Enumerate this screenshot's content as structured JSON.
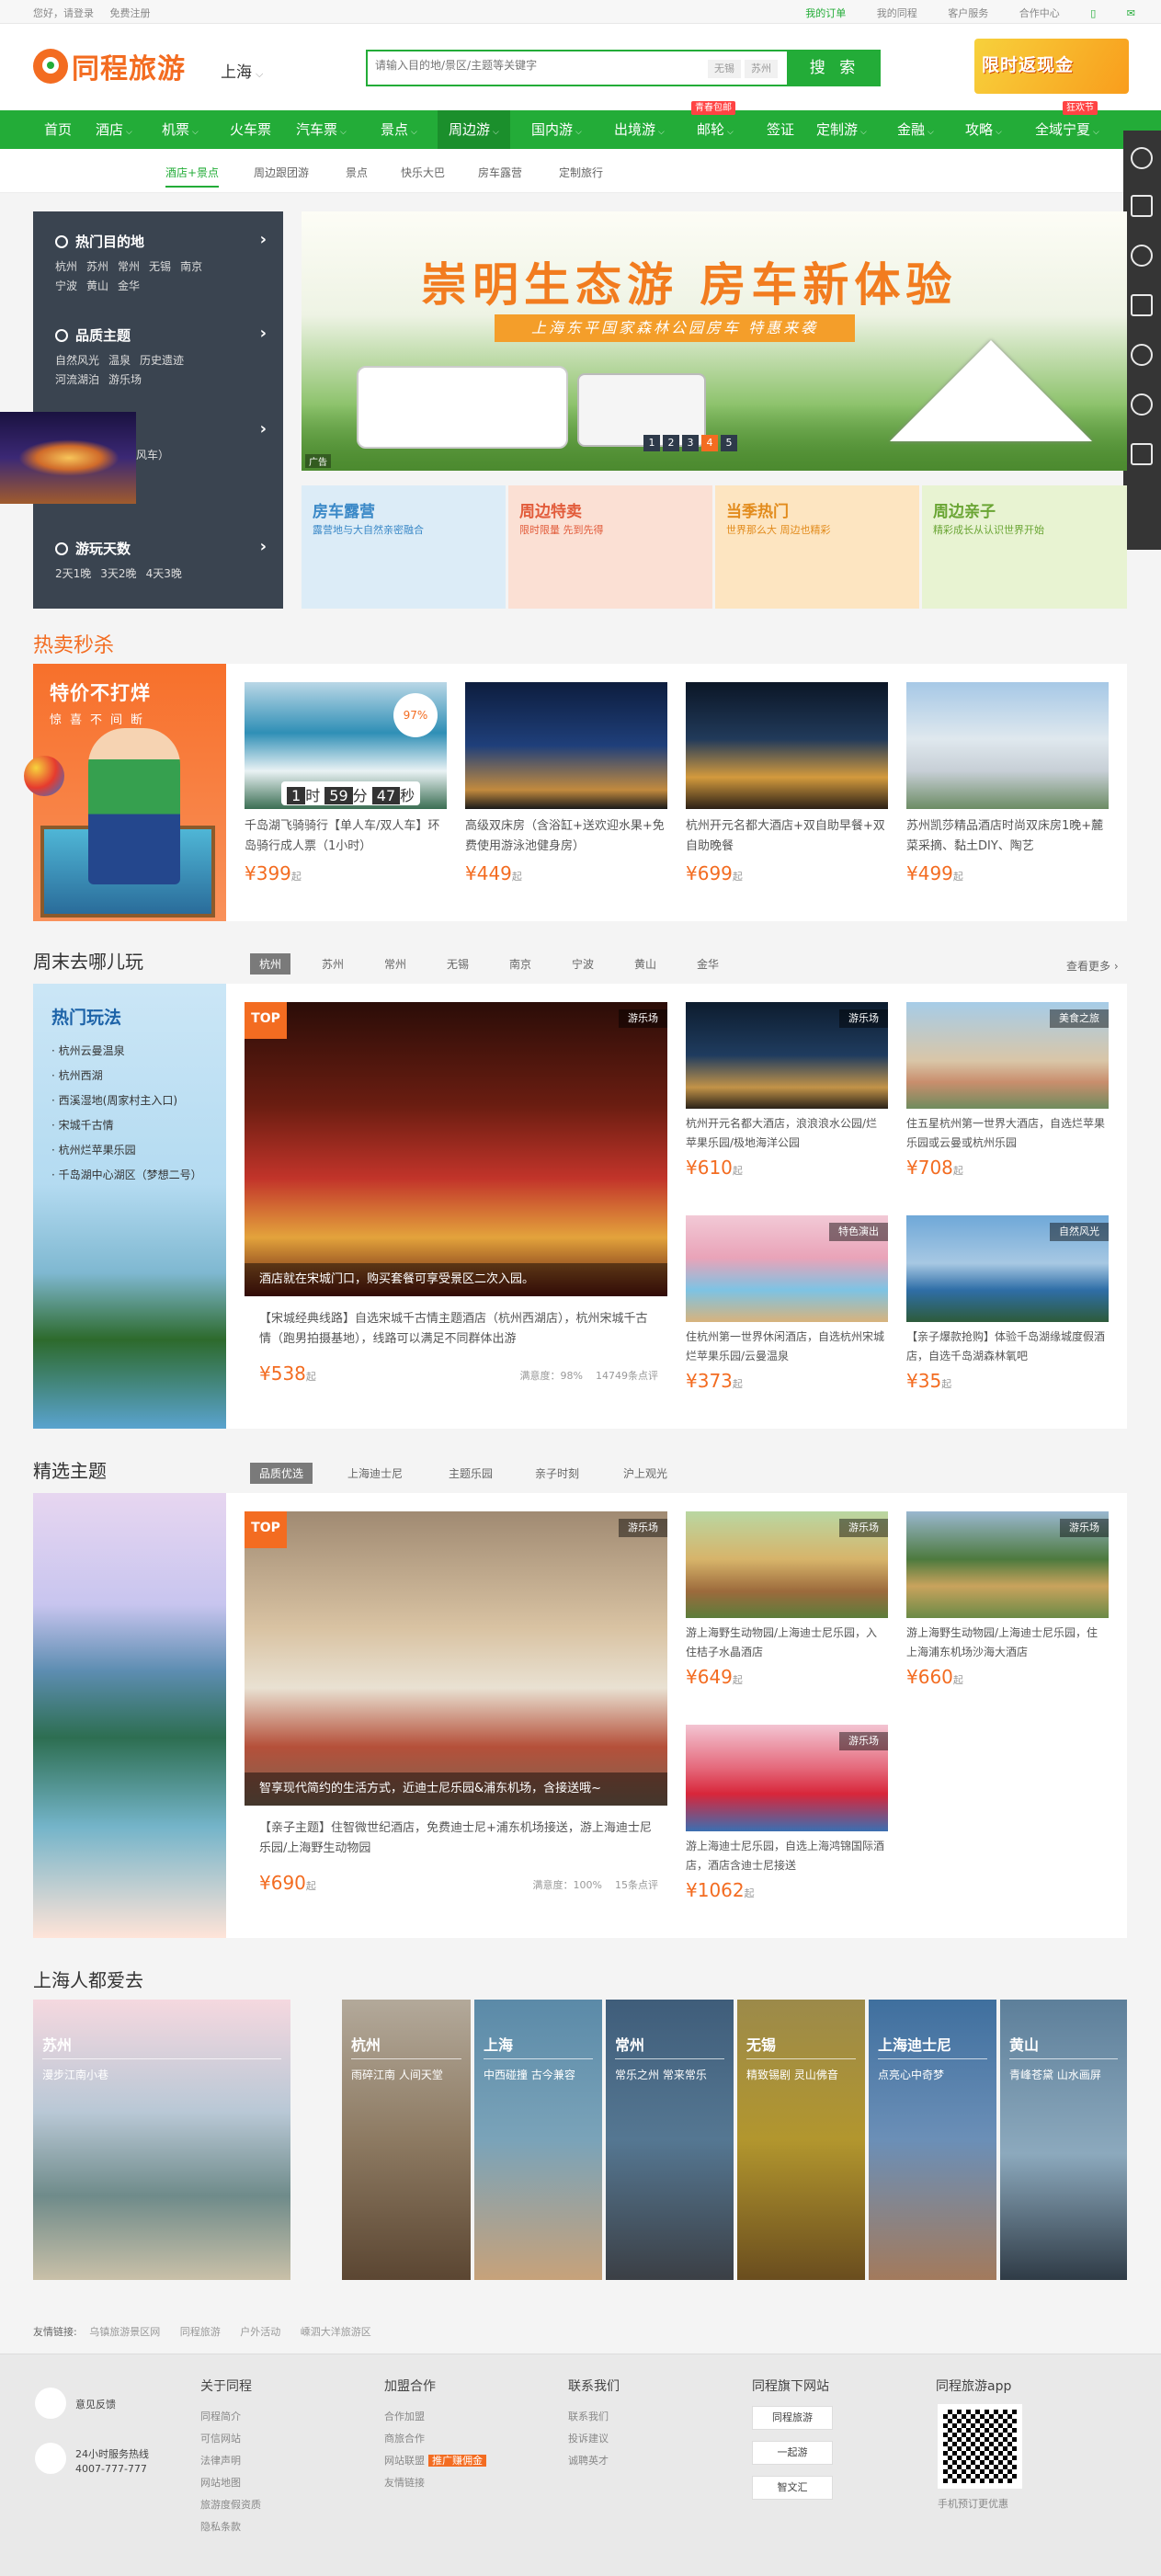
{
  "topbar": {
    "greeting": "您好，请登录",
    "register": "免费注册",
    "my_orders": "我的订单",
    "my_trips": "我的同程",
    "customer_service": "客户服务",
    "partner_center": "合作中心"
  },
  "header": {
    "logo": "同程旅游",
    "city": "上海",
    "search_placeholder": "请输入目的地/景区/主题等关键字",
    "search_tags": [
      "无锡",
      "苏州"
    ],
    "search_button": "搜 索",
    "promo_text": "限时返现金"
  },
  "nav": {
    "items": [
      "首页",
      "酒店",
      "机票",
      "火车票",
      "汽车票",
      "景点",
      "周边游",
      "国内游",
      "出境游",
      "邮轮",
      "签证",
      "定制游",
      "金融",
      "攻略",
      "全域宁夏"
    ],
    "cruise_badge": "青春包邮",
    "ningxia_badge": "狂欢节",
    "active": "周边游"
  },
  "subnav": [
    "酒店+景点",
    "周边跟团游",
    "景点",
    "快乐大巴",
    "房车露营",
    "定制旅行"
  ],
  "category_panel": [
    {
      "title": "热门目的地",
      "links": [
        "杭州",
        "苏州",
        "常州",
        "无锡",
        "南京",
        "宁波",
        "黄山",
        "金华"
      ]
    },
    {
      "title": "品质主题",
      "links": [
        "自然风光",
        "温泉",
        "历史遗迹",
        "河流湖泊",
        "游乐场"
      ]
    },
    {
      "title": "",
      "links": [
        "公园（水风车）",
        "城"
      ]
    },
    {
      "title": "游玩天数",
      "links": [
        "2天1晚",
        "3天2晚",
        "4天3晚"
      ]
    }
  ],
  "banner": {
    "headline": "崇明生态游 房车新体验",
    "subline": "上海东平国家森林公园房车 特惠来袭",
    "pages": [
      "1",
      "2",
      "3",
      "4",
      "5"
    ],
    "ad_label": "广告"
  },
  "mini_banners": [
    {
      "title": "房车露营",
      "sub": "露营地与大自然亲密融合",
      "bg": "#dcecf7",
      "color": "#3a88c7"
    },
    {
      "title": "周边特卖",
      "sub": "限时限量 先到先得",
      "bg": "#fbe0d4",
      "color": "#e25b3a"
    },
    {
      "title": "当季热门",
      "sub": "世界那么大 周边也精彩",
      "bg": "#fde5c1",
      "color": "#e28b1c"
    },
    {
      "title": "周边亲子",
      "sub": "精彩成长从认识世界开始",
      "bg": "#e8f3d2",
      "color": "#6aa534"
    }
  ],
  "hot_sale": {
    "section_title": "热卖秒杀",
    "left_title": "特价不打烊",
    "left_sub": "惊喜不间断",
    "timer": {
      "h": "1",
      "h_unit": "时",
      "m": "59",
      "m_unit": "分",
      "s": "47",
      "s_unit": "秒"
    },
    "discount": "97%",
    "products": [
      {
        "name": "千岛湖飞骑骑行【单人车/双人车】环岛骑行成人票（1小时）",
        "price": "399",
        "unit": "起"
      },
      {
        "name": "高级双床房（含浴缸+送欢迎水果+免费使用游泳池健身房）",
        "price": "449",
        "unit": "起"
      },
      {
        "name": "杭州开元名都大酒店+双自助早餐+双自助晚餐",
        "price": "699",
        "unit": "起"
      },
      {
        "name": "苏州凯莎精品酒店时尚双床房1晚+麓菜采摘、黏土DIY、陶艺",
        "price": "499",
        "unit": "起"
      }
    ]
  },
  "weekend": {
    "section_title": "周末去哪儿玩",
    "tabs": [
      "杭州",
      "苏州",
      "常州",
      "无锡",
      "南京",
      "宁波",
      "黄山",
      "金华"
    ],
    "more": "查看更多 ›",
    "side_title": "热门玩法",
    "side_items": [
      "杭州云曼温泉",
      "杭州西湖",
      "西溪湿地(周家村主入口)",
      "宋城千古情",
      "杭州烂苹果乐园",
      "千岛湖中心湖区（梦想二号）"
    ],
    "big": {
      "top": "TOP",
      "tag": "游乐场",
      "caption": "酒店就在宋城门口，购买套餐可享受景区二次入园。",
      "name": "【宋城经典线路】自选宋城千古情主题酒店（杭州西湖店），杭州宋城千古情（跑男拍摄基地），线路可以满足不同群体出游",
      "price": "538",
      "unit": "起",
      "satisfaction": "满意度：98%",
      "reviews": "14749条点评"
    },
    "cards": [
      {
        "tag": "游乐场",
        "name": "杭州开元名都大酒店，浪浪浪水公园/烂苹果乐园/极地海洋公园",
        "price": "610",
        "unit": "起"
      },
      {
        "tag": "美食之旅",
        "name": "住五星杭州第一世界大酒店，自选烂苹果乐园或云曼或杭州乐园",
        "price": "708",
        "unit": "起"
      },
      {
        "tag": "特色演出",
        "name": "住杭州第一世界休闲酒店，自选杭州宋城烂苹果乐园/云曼温泉",
        "price": "373",
        "unit": "起"
      },
      {
        "tag": "自然风光",
        "name": "【亲子爆款抢购】体验千岛湖缘城度假酒店，自选千岛湖森林氧吧",
        "price": "35",
        "unit": "起"
      }
    ]
  },
  "theme": {
    "section_title": "精选主题",
    "tabs": [
      "品质优选",
      "上海迪士尼",
      "主题乐园",
      "亲子时刻",
      "沪上观光"
    ],
    "big": {
      "top": "TOP",
      "tag": "游乐场",
      "caption": "智享现代简约的生活方式，近迪士尼乐园&浦东机场，含接送哦~",
      "name": "【亲子主题】住智微世纪酒店，免费迪士尼+浦东机场接送，游上海迪士尼乐园/上海野生动物园",
      "price": "690",
      "unit": "起",
      "satisfaction": "满意度：100%",
      "reviews": "15条点评"
    },
    "cards": [
      {
        "tag": "游乐场",
        "name": "游上海野生动物园/上海迪士尼乐园，入住桔子水晶酒店",
        "price": "649",
        "unit": "起"
      },
      {
        "tag": "游乐场",
        "name": "游上海野生动物园/上海迪士尼乐园，住上海浦东机场沙海大酒店",
        "price": "660",
        "unit": "起"
      },
      {
        "tag": "游乐场",
        "name": "游上海迪士尼乐园，自选上海鸿锦国际酒店，酒店含迪士尼接送",
        "price": "1062",
        "unit": "起"
      }
    ]
  },
  "shanghai": {
    "section_title": "上海人都爱去",
    "cities": [
      {
        "name": "苏州",
        "sub": "漫步江南小巷",
        "bg": "linear-gradient(180deg,#f5d8df 0%,#b9c8d6 40%,#6f8b8a 70%,#c9c0a8 100%)"
      },
      {
        "name": "杭州",
        "sub": "雨碎江南 人间天堂",
        "bg": "linear-gradient(180deg,#b3a99a 0%,#8d7a62 50%,#5b4632 100%)"
      },
      {
        "name": "上海",
        "sub": "中西碰撞 古今兼容",
        "bg": "linear-gradient(180deg,#5b8aa8 0%,#7aa3b9 50%,#c7a27a 100%)"
      },
      {
        "name": "常州",
        "sub": "常乐之州 常来常乐",
        "bg": "linear-gradient(180deg,#3f5d7a 0%,#557792 50%,#3b3f45 100%)"
      },
      {
        "name": "无锡",
        "sub": "精致锡剧 灵山佛音",
        "bg": "linear-gradient(180deg,#9c8a4a 0%,#b2962e 50%,#6a4d1e 100%)"
      },
      {
        "name": "上海迪士尼",
        "sub": "点亮心中奇梦",
        "bg": "linear-gradient(180deg,#3f6f9e 0%,#6b8fb7 50%,#a37a5c 100%)"
      },
      {
        "name": "黄山",
        "sub": "青峰苍黛 山水画屏",
        "bg": "linear-gradient(180deg,#5d7f9a 0%,#8ca9bd 55%,#2f3b46 100%)"
      }
    ]
  },
  "friend_links": {
    "label": "友情链接:",
    "links": [
      "乌镇旅游景区网",
      "同程旅游",
      "户外活动",
      "嵊泗大洋旅游区"
    ]
  },
  "footer": {
    "feedback": "意见反馈",
    "hotline_label": "24小时服务热线",
    "hotline": "4007-777-777",
    "columns": [
      {
        "title": "关于同程",
        "links": [
          "同程简介",
          "可信网站",
          "法律声明",
          "网站地图",
          "旅游度假资质",
          "隐私条款"
        ]
      },
      {
        "title": "加盟合作",
        "links": [
          "合作加盟",
          "商旅合作",
          "网站联盟",
          "友情链接"
        ],
        "hot": "推广赚佣金"
      },
      {
        "title": "联系我们",
        "links": [
          "联系我们",
          "投诉建议",
          "诚聘英才"
        ]
      },
      {
        "title": "同程旗下网站",
        "brands": [
          "同程旅游",
          "一起游",
          "智文汇"
        ]
      },
      {
        "title": "同程旅游app",
        "qr_caption": "手机预订更优惠"
      }
    ]
  },
  "colors": {
    "brand_green": "#23ac38",
    "brand_orange": "#f36c21"
  }
}
